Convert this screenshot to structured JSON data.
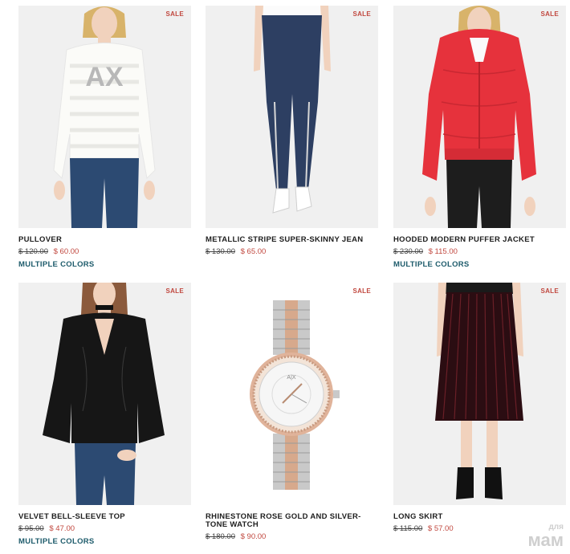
{
  "products": [
    {
      "name": "PULLOVER",
      "old_price": "$ 120.00",
      "new_price": "$ 60.00",
      "colors": "MULTIPLE COLORS",
      "sale": "SALE"
    },
    {
      "name": "METALLIC STRIPE SUPER-SKINNY JEAN",
      "old_price": "$ 130.00",
      "new_price": "$ 65.00",
      "sale": "SALE"
    },
    {
      "name": "HOODED MODERN PUFFER JACKET",
      "old_price": "$ 230.00",
      "new_price": "$ 115.00",
      "colors": "MULTIPLE COLORS",
      "sale": "SALE"
    },
    {
      "name": "VELVET BELL-SLEEVE TOP",
      "old_price": "$ 95.00",
      "new_price": "$ 47.00",
      "colors": "MULTIPLE COLORS",
      "sale": "SALE"
    },
    {
      "name": "RHINESTONE ROSE GOLD AND SILVER-TONE WATCH",
      "old_price": "$ 180.00",
      "new_price": "$ 90.00",
      "sale": "SALE"
    },
    {
      "name": "LONG SKIRT",
      "old_price": "$ 115.00",
      "new_price": "$ 57.00",
      "sale": "SALE"
    }
  ],
  "watermark": {
    "line1": "для",
    "line2": "мам"
  },
  "colors": {
    "sale": "#c1483f",
    "multiple_colors": "#1d5b6b"
  }
}
